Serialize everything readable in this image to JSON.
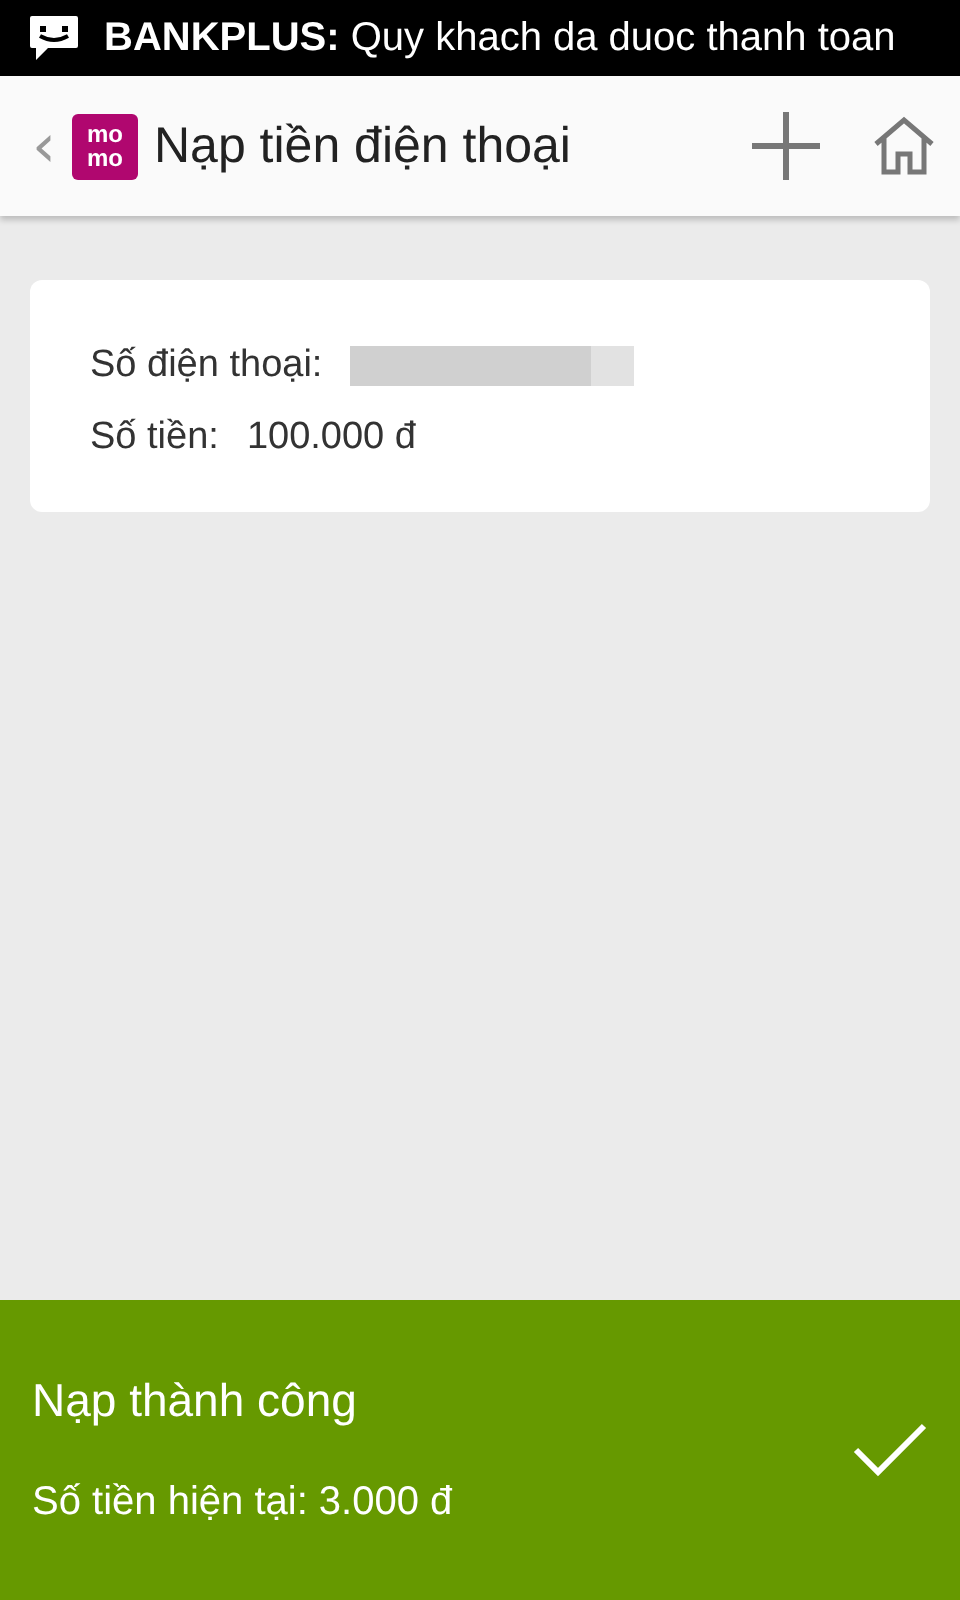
{
  "status_bar": {
    "notification": "**BANKPLUS:** Quy khach da duoc thanh toan"
  },
  "action_bar": {
    "back": "‹",
    "logo": [
      "mo",
      "mo"
    ],
    "title": "Nạp tiền điện thoại"
  },
  "details": [
    {
      "kind": "redacted",
      "label": "Số điện thoại:"
    },
    {
      "kind": "text",
      "label": "Số tiền:",
      "value": "100.000 đ"
    }
  ],
  "result": {
    "title": "Nạp thành công",
    "message": "Số tiền hiện tại: 3.000 đ"
  }
}
